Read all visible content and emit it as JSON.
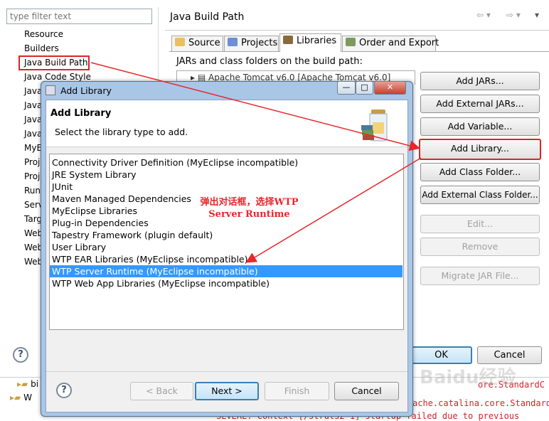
{
  "properties": {
    "filter_placeholder": "type filter text",
    "nav_items": [
      "Resource",
      "Builders",
      "Java Build Path",
      "Java Code Style",
      "Java",
      "Java",
      "Java",
      "Java",
      "MyE",
      "Proj",
      "Proj",
      "Run",
      "Serv",
      "Targ",
      "Web",
      "Web",
      "Web"
    ],
    "page_title": "Java Build Path",
    "tabs": [
      "Source",
      "Projects",
      "Libraries",
      "Order and Export"
    ],
    "jars_label": "JARs and class folders on the build path:",
    "jar_item": "Apache Tomcat v6.0 [Apache Tomcat v6.0]",
    "buttons": [
      "Add JARs...",
      "Add External JARs...",
      "Add Variable...",
      "Add Library...",
      "Add Class Folder...",
      "Add External Class Folder...",
      "Edit...",
      "Remove",
      "Migrate JAR File..."
    ],
    "ok": "OK",
    "cancel": "Cancel",
    "help_icon": "?"
  },
  "console": {
    "lines": [
      "ore.StandardC",
      "ache.catalina.core.StandardC",
      "SEVERE: Context [/struts2-1] startup failed due to previous"
    ],
    "tree_items": [
      "bi",
      "W"
    ]
  },
  "dialog": {
    "title": "Add Library",
    "heading": "Add Library",
    "subtitle": "Select the library type to add.",
    "libraries": [
      "Connectivity Driver Definition (MyEclipse incompatible)",
      "JRE System Library",
      "JUnit",
      "Maven Managed Dependencies",
      "MyEclipse Libraries",
      "Plug-in Dependencies",
      "Tapestry Framework (plugin default)",
      "User Library",
      "WTP EAR Libraries (MyEclipse incompatible)",
      "WTP Server Runtime (MyEclipse incompatible)",
      "WTP Web App Libraries (MyEclipse incompatible)"
    ],
    "selected_index": 9,
    "back": "< Back",
    "next": "Next >",
    "finish": "Finish",
    "cancel": "Cancel",
    "help_icon": "?",
    "window_buttons": {
      "minimize": "—",
      "maximize": "□",
      "close": "✕"
    }
  },
  "annotation": {
    "line1": "弹出对话框，选择WTP",
    "line2": "Server Runtime"
  },
  "watermark": "Baidu经验",
  "colors": {
    "accent": "#3399ff",
    "annotation": "#e8262b",
    "dialog_frame": "#a9c6e6"
  }
}
